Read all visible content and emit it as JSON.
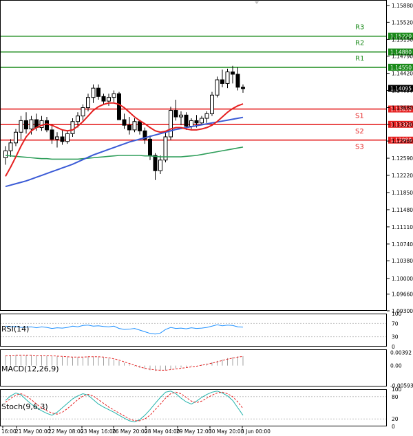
{
  "chart_data": {
    "type": "candlestick",
    "main": {
      "ylim": [
        1.093,
        1.16
      ],
      "y_ticks": [
        "1.15880",
        "1.15520",
        "1.15150",
        "1.14790",
        "1.14420",
        "1.14050",
        "1.13680",
        "1.13320",
        "1.12960",
        "1.12590",
        "1.12220",
        "1.11850",
        "1.11480",
        "1.11110",
        "1.10740",
        "1.10380",
        "1.10000",
        "1.09660",
        "1.09300"
      ],
      "x_labels": [
        "16:00",
        "21 May 00:00",
        "22 May 08:00",
        "23 May 16:00",
        "26 May 20:00",
        "28 May 04:00",
        "29 May 12:00",
        "30 May 20:00",
        "3 Jun 00:00"
      ],
      "last_price": "1.14095",
      "levels": [
        {
          "name": "R3",
          "value": 1.1522,
          "label": "1.15220",
          "color": "#1a8a1a"
        },
        {
          "name": "R2",
          "value": 1.1488,
          "label": "1.14880",
          "color": "#1a8a1a"
        },
        {
          "name": "R1",
          "value": 1.1455,
          "label": "1.14550",
          "color": "#1a8a1a"
        },
        {
          "name": "S1",
          "value": 1.1365,
          "label": "1.13650",
          "color": "#e52020"
        },
        {
          "name": "S2",
          "value": 1.1332,
          "label": "1.13320",
          "color": "#e52020"
        },
        {
          "name": "S3",
          "value": 1.1298,
          "label": "1.12980",
          "color": "#e52020"
        }
      ],
      "candles": [
        [
          1.126,
          1.1285,
          1.1245,
          1.1275
        ],
        [
          1.1275,
          1.13,
          1.1262,
          1.1292
        ],
        [
          1.1292,
          1.1322,
          1.1285,
          1.1315
        ],
        [
          1.1315,
          1.135,
          1.13,
          1.134
        ],
        [
          1.134,
          1.1358,
          1.1312,
          1.1322
        ],
        [
          1.1322,
          1.135,
          1.131,
          1.1342
        ],
        [
          1.1342,
          1.1355,
          1.1318,
          1.1325
        ],
        [
          1.1325,
          1.135,
          1.1318,
          1.134
        ],
        [
          1.134,
          1.1348,
          1.1315,
          1.132
        ],
        [
          1.132,
          1.1332,
          1.129,
          1.13
        ],
        [
          1.13,
          1.1315,
          1.1282,
          1.1305
        ],
        [
          1.1305,
          1.132,
          1.1288,
          1.1295
        ],
        [
          1.1295,
          1.1318,
          1.129,
          1.1312
        ],
        [
          1.1312,
          1.1345,
          1.1305,
          1.1338
        ],
        [
          1.1338,
          1.1358,
          1.1325,
          1.135
        ],
        [
          1.135,
          1.1375,
          1.134,
          1.1368
        ],
        [
          1.1368,
          1.1398,
          1.136,
          1.139
        ],
        [
          1.139,
          1.1418,
          1.1378,
          1.141
        ],
        [
          1.141,
          1.1418,
          1.1385,
          1.1392
        ],
        [
          1.1392,
          1.1398,
          1.1375,
          1.1382
        ],
        [
          1.1382,
          1.1398,
          1.1372,
          1.139
        ],
        [
          1.139,
          1.1405,
          1.138,
          1.1398
        ],
        [
          1.1398,
          1.1402,
          1.136,
          1.1342
        ],
        [
          1.1342,
          1.1355,
          1.1322,
          1.133
        ],
        [
          1.133,
          1.1348,
          1.131,
          1.132
        ],
        [
          1.132,
          1.1345,
          1.1315,
          1.1338
        ],
        [
          1.1338,
          1.1342,
          1.131,
          1.1318
        ],
        [
          1.1318,
          1.1325,
          1.129,
          1.13
        ],
        [
          1.13,
          1.1308,
          1.1255,
          1.1265
        ],
        [
          1.1265,
          1.127,
          1.1212,
          1.1232
        ],
        [
          1.1232,
          1.1265,
          1.1225,
          1.1255
        ],
        [
          1.1255,
          1.1315,
          1.125,
          1.1305
        ],
        [
          1.1305,
          1.137,
          1.1298,
          1.1362
        ],
        [
          1.1362,
          1.1385,
          1.134,
          1.1348
        ],
        [
          1.1348,
          1.136,
          1.133,
          1.1352
        ],
        [
          1.1352,
          1.1358,
          1.132,
          1.1328
        ],
        [
          1.1328,
          1.1345,
          1.1322,
          1.134
        ],
        [
          1.134,
          1.1352,
          1.1325,
          1.1335
        ],
        [
          1.1335,
          1.135,
          1.133,
          1.1345
        ],
        [
          1.1345,
          1.136,
          1.1335,
          1.1355
        ],
        [
          1.1355,
          1.1402,
          1.135,
          1.1395
        ],
        [
          1.1395,
          1.1435,
          1.139,
          1.1428
        ],
        [
          1.1428,
          1.145,
          1.1412,
          1.142
        ],
        [
          1.142,
          1.1452,
          1.141,
          1.1445
        ],
        [
          1.1445,
          1.1458,
          1.142,
          1.144
        ],
        [
          1.144,
          1.1455,
          1.1405,
          1.1412
        ],
        [
          1.1412,
          1.1418,
          1.14,
          1.1409
        ]
      ],
      "ma_fast": [
        1.122,
        1.124,
        1.1262,
        1.1285,
        1.1305,
        1.1318,
        1.1325,
        1.133,
        1.1333,
        1.133,
        1.1325,
        1.132,
        1.1318,
        1.132,
        1.1328,
        1.1338,
        1.135,
        1.1362,
        1.137,
        1.1375,
        1.1378,
        1.1378,
        1.1375,
        1.1368,
        1.1358,
        1.1348,
        1.134,
        1.1333,
        1.1325,
        1.1318,
        1.1315,
        1.1317,
        1.1322,
        1.1325,
        1.1325,
        1.1322,
        1.132,
        1.132,
        1.1322,
        1.1325,
        1.133,
        1.1338,
        1.1348,
        1.1358,
        1.1366,
        1.1372,
        1.1376
      ],
      "ma_mid": [
        1.1198,
        1.1201,
        1.1204,
        1.1207,
        1.121,
        1.1214,
        1.1218,
        1.1222,
        1.1226,
        1.123,
        1.1234,
        1.1238,
        1.1242,
        1.1246,
        1.1251,
        1.1256,
        1.1261,
        1.1266,
        1.127,
        1.1274,
        1.1278,
        1.1282,
        1.1286,
        1.129,
        1.1294,
        1.1297,
        1.13,
        1.1303,
        1.1306,
        1.1309,
        1.1312,
        1.1315,
        1.1318,
        1.1321,
        1.1323,
        1.1325,
        1.1327,
        1.1329,
        1.1331,
        1.1333,
        1.1335,
        1.1337,
        1.1339,
        1.1341,
        1.1343,
        1.1345,
        1.1347
      ],
      "ma_slow": [
        1.1265,
        1.1264,
        1.1263,
        1.1262,
        1.1261,
        1.126,
        1.1259,
        1.1258,
        1.1258,
        1.1257,
        1.1257,
        1.1257,
        1.1257,
        1.1257,
        1.1257,
        1.1258,
        1.1259,
        1.126,
        1.1261,
        1.1262,
        1.1263,
        1.1264,
        1.1265,
        1.1265,
        1.1265,
        1.1265,
        1.1265,
        1.1264,
        1.1264,
        1.1263,
        1.1262,
        1.1262,
        1.1262,
        1.1262,
        1.1262,
        1.1263,
        1.1264,
        1.1265,
        1.1267,
        1.1269,
        1.1271,
        1.1273,
        1.1275,
        1.1277,
        1.1279,
        1.1281,
        1.1283
      ]
    },
    "rsi": {
      "label": "RSI(14)",
      "ylim": [
        0,
        100
      ],
      "y_ticks": [
        "100",
        "70",
        "30",
        "0"
      ],
      "values": [
        62,
        60,
        61,
        58,
        59,
        60,
        57,
        60,
        58,
        55,
        57,
        56,
        58,
        62,
        60,
        64,
        65,
        62,
        63,
        61,
        60,
        62,
        55,
        52,
        53,
        55,
        50,
        45,
        40,
        38,
        41,
        52,
        58,
        55,
        56,
        54,
        57,
        55,
        56,
        58,
        62,
        66,
        63,
        65,
        64,
        60,
        59
      ]
    },
    "macd": {
      "label": "MACD(12,26,9)",
      "y_ticks": [
        "0.00392",
        "0.00",
        "-0.005934"
      ],
      "ylim": [
        -0.0062,
        0.0048
      ],
      "hist": [
        0.003,
        0.0031,
        0.0032,
        0.0032,
        0.0031,
        0.0031,
        0.003,
        0.003,
        0.0029,
        0.0028,
        0.0027,
        0.0026,
        0.0025,
        0.0025,
        0.0025,
        0.0026,
        0.0027,
        0.0027,
        0.0026,
        0.0024,
        0.0021,
        0.0018,
        0.0013,
        0.0008,
        0.0003,
        -0.0002,
        -0.0007,
        -0.0011,
        -0.0014,
        -0.0016,
        -0.0016,
        -0.0014,
        -0.0011,
        -0.0008,
        -0.0006,
        -0.0004,
        -0.0002,
        0.0,
        0.0003,
        0.0006,
        0.001,
        0.0014,
        0.0018,
        0.0022,
        0.0025,
        0.0027,
        0.0028
      ],
      "signal": [
        0.0029,
        0.003,
        0.0031,
        0.0031,
        0.0031,
        0.0031,
        0.003,
        0.003,
        0.003,
        0.0029,
        0.0028,
        0.0027,
        0.0026,
        0.0025,
        0.0025,
        0.0025,
        0.0026,
        0.0026,
        0.0026,
        0.0025,
        0.0023,
        0.002,
        0.0016,
        0.0011,
        0.0006,
        0.0001,
        -0.0004,
        -0.0008,
        -0.0011,
        -0.0013,
        -0.0014,
        -0.0014,
        -0.0012,
        -0.001,
        -0.0008,
        -0.0006,
        -0.0004,
        -0.0002,
        0.0001,
        0.0004,
        0.0007,
        0.0011,
        0.0015,
        0.0019,
        0.0022,
        0.0025,
        0.0027
      ]
    },
    "stoch": {
      "label": "Stoch(9,6,3)",
      "ylim": [
        0,
        100
      ],
      "y_ticks": [
        "100",
        "80",
        "20",
        "0"
      ],
      "k": [
        70,
        82,
        90,
        85,
        72,
        60,
        50,
        42,
        35,
        30,
        38,
        50,
        62,
        74,
        82,
        88,
        84,
        72,
        60,
        52,
        45,
        38,
        30,
        22,
        15,
        12,
        18,
        30,
        45,
        62,
        78,
        92,
        95,
        88,
        76,
        66,
        60,
        68,
        78,
        86,
        92,
        95,
        90,
        82,
        70,
        50,
        30
      ],
      "d": [
        65,
        75,
        84,
        88,
        82,
        72,
        60,
        50,
        42,
        36,
        33,
        38,
        48,
        60,
        72,
        82,
        86,
        82,
        72,
        62,
        52,
        44,
        36,
        28,
        20,
        15,
        15,
        20,
        30,
        45,
        60,
        76,
        88,
        92,
        88,
        78,
        68,
        64,
        68,
        76,
        84,
        90,
        92,
        88,
        80,
        66,
        48
      ]
    }
  }
}
